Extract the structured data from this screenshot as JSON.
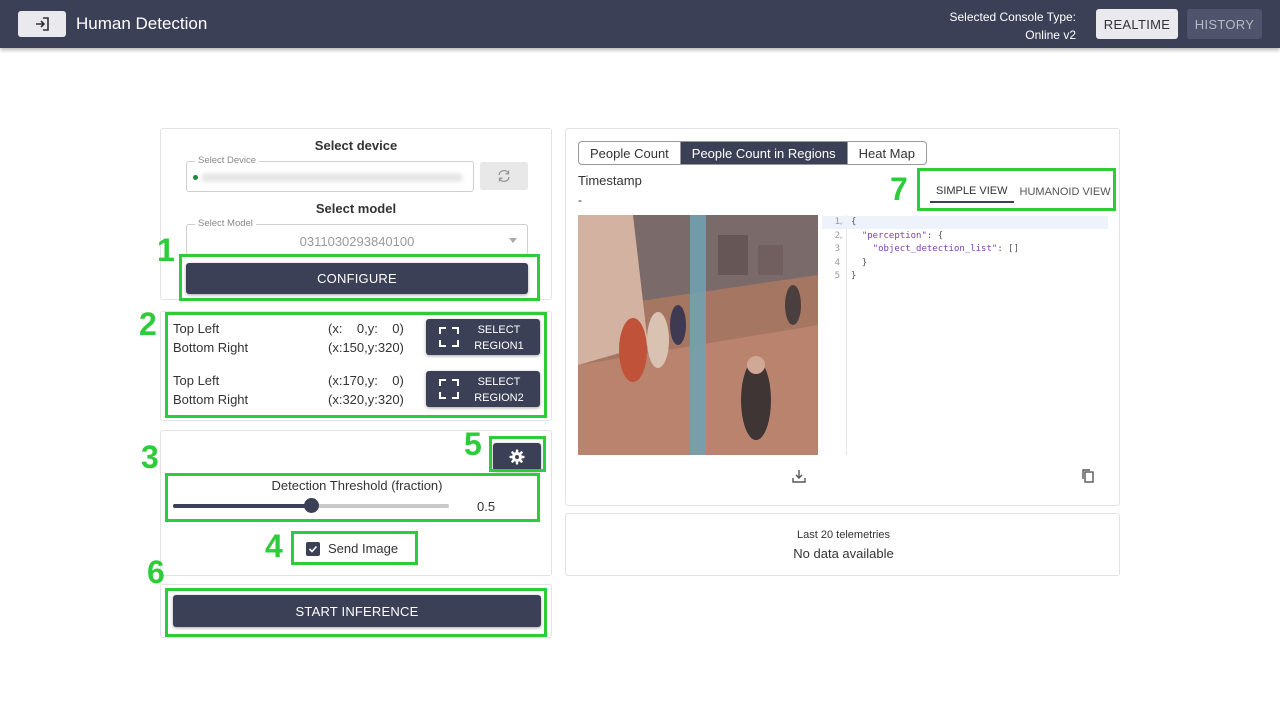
{
  "header": {
    "title": "Human Detection",
    "console_type_label": "Selected Console Type:",
    "console_type_value": "Online v2",
    "realtime_label": "REALTIME",
    "history_label": "HISTORY"
  },
  "device": {
    "section_title": "Select device",
    "field_label": "Select Device",
    "model_section_title": "Select model",
    "model_field_label": "Select Model",
    "model_value": "0311030293840100",
    "configure_label": "CONFIGURE"
  },
  "regions": [
    {
      "top_left_label": "Top Left",
      "top_left_coord": "(x:    0,y:    0)",
      "bottom_right_label": "Bottom Right",
      "bottom_right_coord": "(x:150,y:320)",
      "button_line1": "SELECT",
      "button_line2": "REGION1"
    },
    {
      "top_left_label": "Top Left",
      "top_left_coord": "(x:170,y:    0)",
      "bottom_right_label": "Bottom Right",
      "bottom_right_coord": "(x:320,y:320)",
      "button_line1": "SELECT",
      "button_line2": "REGION2"
    }
  ],
  "threshold": {
    "label": "Detection Threshold (fraction)",
    "value": 0.5,
    "value_text": "0.5"
  },
  "send_image": {
    "label": "Send Image",
    "checked": true
  },
  "start_label": "START INFERENCE",
  "view": {
    "tabs": [
      {
        "label": "People Count",
        "active": false
      },
      {
        "label": "People Count in Regions",
        "active": true
      },
      {
        "label": "Heat Map",
        "active": false
      }
    ],
    "timestamp_label": "Timestamp",
    "timestamp_value": "-",
    "toggle": [
      {
        "label": "SIMPLE VIEW",
        "active": true
      },
      {
        "label": "HUMANOID VIEW",
        "active": false
      }
    ],
    "code_lines": [
      {
        "n": "1",
        "text": "{"
      },
      {
        "n": "2",
        "text": "  \"perception\": {"
      },
      {
        "n": "3",
        "text": "    \"object_detection_list\": []"
      },
      {
        "n": "4",
        "text": "  }"
      },
      {
        "n": "5",
        "text": "}"
      }
    ]
  },
  "telemetry": {
    "title": "Last 20 telemetries",
    "message": "No data available"
  },
  "annotations": [
    "1",
    "2",
    "3",
    "4",
    "5",
    "6",
    "7"
  ],
  "colors": {
    "header_bg": "#3c4057",
    "annotation": "#2ccc3a",
    "button_dark": "#3c4057"
  }
}
